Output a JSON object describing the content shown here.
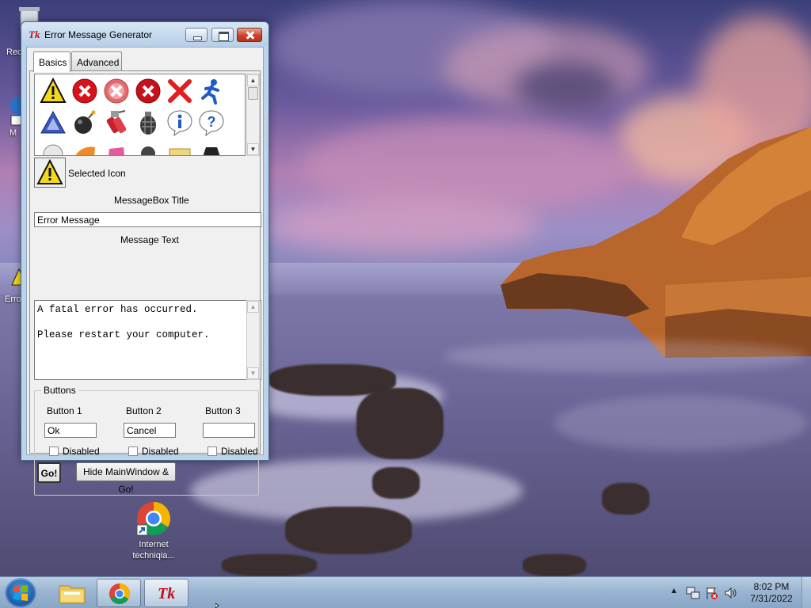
{
  "desktop": {
    "icons": [
      {
        "label": "Rec"
      },
      {
        "label": "M"
      },
      {
        "label": "Erro"
      },
      {
        "label": "Internet techniqia..."
      }
    ]
  },
  "window": {
    "title": "Error Message Generator",
    "tabs": [
      "Basics",
      "Advanced"
    ],
    "selected_icon_label": "Selected Icon",
    "title_section_label": "MessageBox Title",
    "title_value": "Error Message",
    "text_section_label": "Message Text",
    "message_text": "A fatal error has occurred.\n\nPlease restart your computer.",
    "buttons_group": {
      "legend": "Buttons",
      "button1_label": "Button 1",
      "button2_label": "Button 2",
      "button3_label": "Button 3",
      "button1_value": "Ok",
      "button2_value": "Cancel",
      "button3_value": "",
      "disabled_label": "Disabled",
      "go_label": "Go!",
      "hide_go_label": "Hide MainWindow & Go!"
    },
    "icon_grid": [
      "warning-icon",
      "error-circle-icon",
      "error-circle-faded-icon",
      "error-circle-icon",
      "red-x-icon",
      "running-man-icon",
      "hazard-triangle-icon",
      "bomb-icon",
      "dynamite-icon",
      "grenade-icon",
      "info-icon",
      "question-icon"
    ]
  },
  "taskbar": {
    "time": "8:02 PM",
    "date": "7/31/2022",
    "pinned": [
      "file-explorer-icon",
      "chrome-icon",
      "tk-app-icon"
    ]
  },
  "colors": {
    "error_red": "#d8121a",
    "warning_yellow": "#f3d91a",
    "info_blue": "#1e5bc8"
  }
}
